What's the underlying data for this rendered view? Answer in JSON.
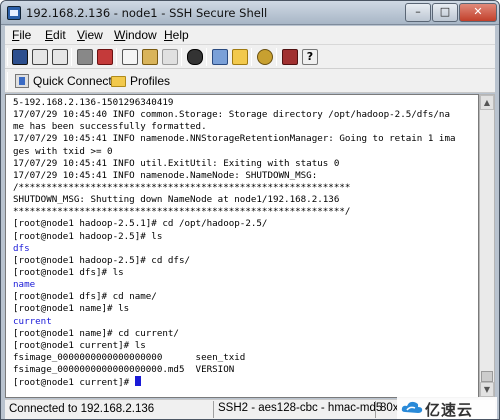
{
  "window": {
    "title": "192.168.2.136 - node1 - SSH Secure Shell",
    "minimize_label": "–",
    "maximize_label": "□",
    "close_label": "✕"
  },
  "menu": {
    "items": [
      {
        "mnemonic": "F",
        "rest": "ile"
      },
      {
        "mnemonic": "E",
        "rest": "dit"
      },
      {
        "mnemonic": "V",
        "rest": "iew"
      },
      {
        "mnemonic": "W",
        "rest": "indow"
      },
      {
        "mnemonic": "H",
        "rest": "elp"
      }
    ]
  },
  "toolbar": {
    "icons": [
      "save-icon",
      "print-icon",
      "print-preview-icon",
      "disconnect-icon",
      "new-connection-icon",
      "copy-icon",
      "paste-icon",
      "paste-disabled-icon",
      "find-icon",
      "file-transfer-icon",
      "folder-open-icon",
      "settings-icon",
      "profile-icon",
      "help-icon"
    ]
  },
  "toolbar2": {
    "quick_connect_label": "Quick Connect",
    "profiles_label": "Profiles"
  },
  "terminal": {
    "lines": [
      {
        "text": "5-192.168.2.136-1501296340419",
        "color": "black"
      },
      {
        "text": "17/07/29 10:45:40 INFO common.Storage: Storage directory /opt/hadoop-2.5/dfs/na",
        "color": "black"
      },
      {
        "text": "me has been successfully formatted.",
        "color": "black"
      },
      {
        "text": "17/07/29 10:45:41 INFO namenode.NNStorageRetentionManager: Going to retain 1 ima",
        "color": "black"
      },
      {
        "text": "ges with txid >= 0",
        "color": "black"
      },
      {
        "text": "17/07/29 10:45:41 INFO util.ExitUtil: Exiting with status 0",
        "color": "black"
      },
      {
        "text": "17/07/29 10:45:41 INFO namenode.NameNode: SHUTDOWN_MSG:",
        "color": "black"
      },
      {
        "text": "/************************************************************",
        "color": "black"
      },
      {
        "text": "SHUTDOWN_MSG: Shutting down NameNode at node1/192.168.2.136",
        "color": "black"
      },
      {
        "text": "************************************************************/",
        "color": "black"
      },
      {
        "text": "[root@node1 hadoop-2.5.1]# cd /opt/hadoop-2.5/",
        "color": "black"
      },
      {
        "text": "[root@node1 hadoop-2.5]# ls",
        "color": "black"
      },
      {
        "text": "dfs",
        "color": "blue"
      },
      {
        "text": "[root@node1 hadoop-2.5]# cd dfs/",
        "color": "black"
      },
      {
        "text": "[root@node1 dfs]# ls",
        "color": "black"
      },
      {
        "text": "name",
        "color": "blue"
      },
      {
        "text": "[root@node1 dfs]# cd name/",
        "color": "black"
      },
      {
        "text": "[root@node1 name]# ls",
        "color": "black"
      },
      {
        "text": "current",
        "color": "blue"
      },
      {
        "text": "[root@node1 name]# cd current/",
        "color": "black"
      },
      {
        "text": "[root@node1 current]# ls",
        "color": "black"
      },
      {
        "text": "fsimage_0000000000000000000      seen_txid",
        "color": "black"
      },
      {
        "text": "fsimage_0000000000000000000.md5  VERSION",
        "color": "black"
      },
      {
        "text": "[root@node1 current]# ",
        "color": "black"
      }
    ]
  },
  "statusbar": {
    "connection": "Connected to 192.168.2.136",
    "crypto": "SSH2 - aes128-cbc - hmac-md5",
    "size": "80x"
  },
  "watermark": {
    "text": "亿速云"
  },
  "colors": {
    "terminal_blue": "#1a1ad8",
    "title_gradient_top": "#cfd9e4",
    "close_button": "#c2402b"
  }
}
